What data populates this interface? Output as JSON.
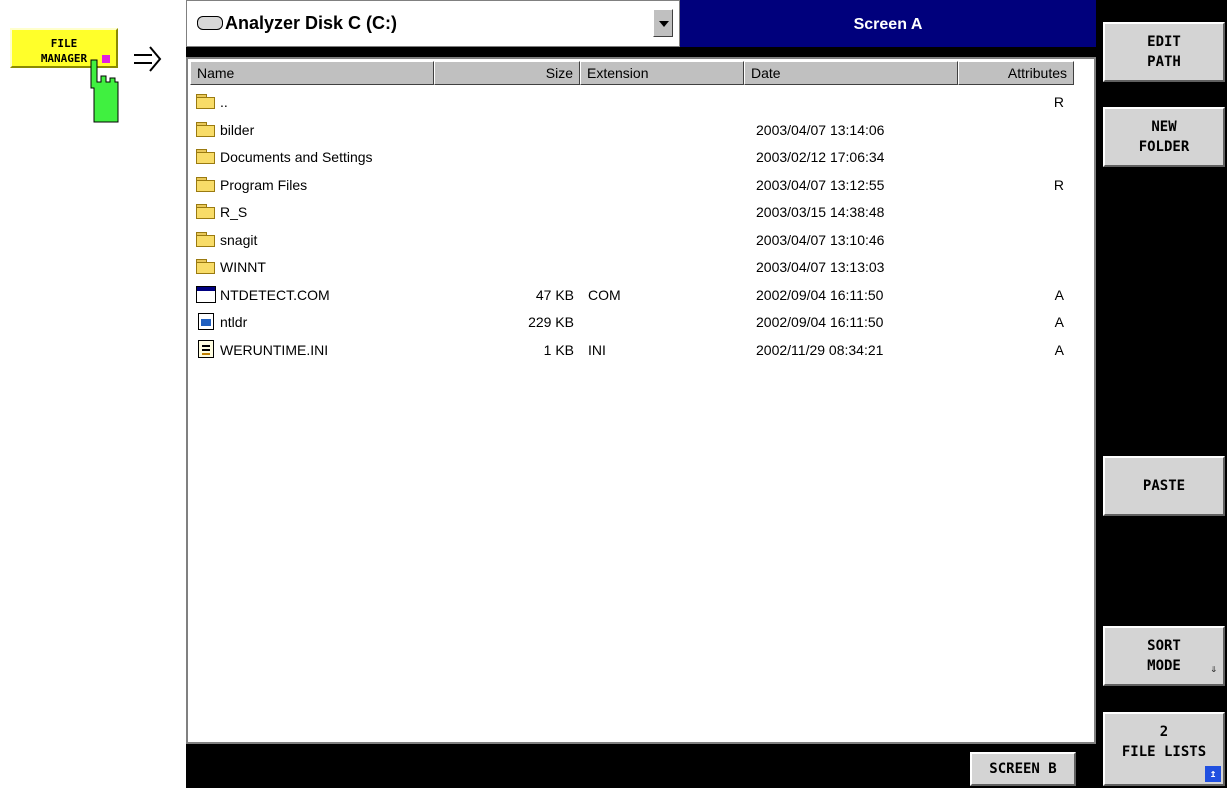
{
  "hint_key": {
    "line1": "FILE",
    "line2": "MANAGER",
    "color": "#ffff2a"
  },
  "drive_select": {
    "label": "Analyzer Disk C (C:)",
    "icon": "hard-drive-icon"
  },
  "screen_title": "Screen A",
  "columns": {
    "name": "Name",
    "size": "Size",
    "extension": "Extension",
    "date": "Date",
    "attributes": "Attributes"
  },
  "files": [
    {
      "name": "..",
      "size": "",
      "ext": "",
      "date": "",
      "attr": "R",
      "icon": "folder-icon"
    },
    {
      "name": "bilder",
      "size": "",
      "ext": "",
      "date": "2003/04/07  13:14:06",
      "attr": "",
      "icon": "folder-icon"
    },
    {
      "name": "Documents and Settings",
      "size": "",
      "ext": "",
      "date": "2003/02/12  17:06:34",
      "attr": "",
      "icon": "folder-icon"
    },
    {
      "name": "Program Files",
      "size": "",
      "ext": "",
      "date": "2003/04/07  13:12:55",
      "attr": "R",
      "icon": "folder-icon"
    },
    {
      "name": "R_S",
      "size": "",
      "ext": "",
      "date": "2003/03/15  14:38:48",
      "attr": "",
      "icon": "folder-icon"
    },
    {
      "name": "snagit",
      "size": "",
      "ext": "",
      "date": "2003/04/07  13:10:46",
      "attr": "",
      "icon": "folder-icon"
    },
    {
      "name": "WINNT",
      "size": "",
      "ext": "",
      "date": "2003/04/07  13:13:03",
      "attr": "",
      "icon": "folder-icon"
    },
    {
      "name": "NTDETECT.COM",
      "size": "47 KB",
      "ext": "COM",
      "date": "2002/09/04  16:11:50",
      "attr": "A",
      "icon": "com-file-icon"
    },
    {
      "name": "ntldr",
      "size": "229 KB",
      "ext": "",
      "date": "2002/09/04  16:11:50",
      "attr": "A",
      "icon": "exe-file-icon"
    },
    {
      "name": "WERUNTIME.INI",
      "size": "1 KB",
      "ext": "INI",
      "date": "2002/11/29  08:34:21",
      "attr": "A",
      "icon": "ini-file-icon"
    }
  ],
  "softkeys": {
    "edit_path": [
      "EDIT",
      "PATH"
    ],
    "new_folder": [
      "NEW",
      "FOLDER"
    ],
    "paste": "PASTE",
    "sort_mode": [
      "SORT",
      "MODE"
    ],
    "file_lists": [
      "2",
      "FILE LISTS"
    ]
  },
  "screen_b": "SCREEN B",
  "colors": {
    "title_bar": "#00007c",
    "softkey_face": "#d4d4d4",
    "background": "#000000"
  }
}
